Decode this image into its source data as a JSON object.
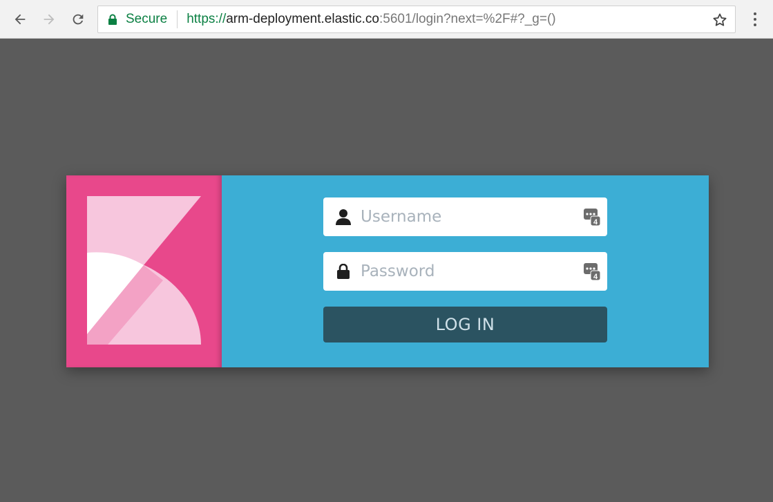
{
  "browser": {
    "secure_label": "Secure",
    "url_scheme": "https://",
    "url_host": "arm-deployment.elastic.co",
    "url_rest": ":5601/login?next=%2F#?_g=()"
  },
  "login": {
    "username_placeholder": "Username",
    "password_placeholder": "Password",
    "button_label": "LOG IN",
    "password_manager_badge": "4"
  },
  "colors": {
    "page_background": "#5b5b5b",
    "brand_pink": "#e8488b",
    "form_blue": "#3caed5",
    "button_dark": "#2b5361",
    "secure_green": "#0b8043"
  },
  "icons": {
    "back": "arrow-left",
    "forward": "arrow-right",
    "reload": "reload",
    "secure": "padlock",
    "bookmark": "star-outline",
    "menu": "vertical-dots",
    "username": "user-silhouette",
    "password": "padlock",
    "password_manager": "key-badge"
  }
}
